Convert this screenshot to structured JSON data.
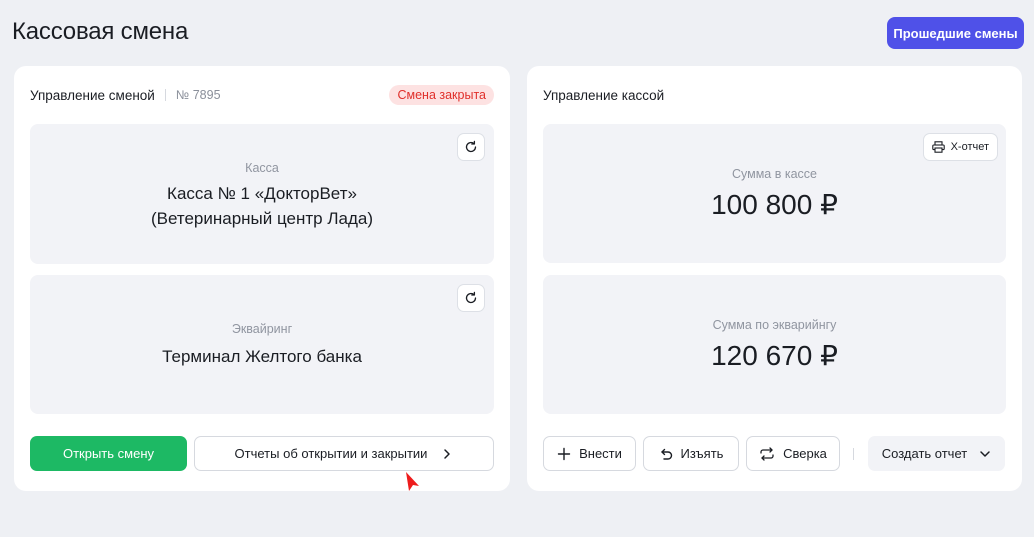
{
  "page": {
    "title": "Кассовая смена"
  },
  "header": {
    "history_button": "Прошедшие смены"
  },
  "shift_card": {
    "title": "Управление сменой",
    "shift_number": "№ 7895",
    "status": "Смена закрыта",
    "register": {
      "caption": "Касса",
      "line1": "Касса № 1 «ДокторВет»",
      "line2": "(Ветеринарный центр Лада)"
    },
    "acquiring": {
      "caption": "Эквайринг",
      "value": "Терминал Желтого банка"
    },
    "open_button": "Открыть смену",
    "reports_button": "Отчеты об открытии и закрытии"
  },
  "cash_card": {
    "title": "Управление кассой",
    "xreport_button": "X-отчет",
    "cash_sum": {
      "caption": "Сумма в кассе",
      "value": "100 800 ₽"
    },
    "acquiring_sum": {
      "caption": "Сумма по экварийнгу",
      "value": "120 670 ₽"
    },
    "deposit_button": "Внести",
    "withdraw_button": "Изъять",
    "reconcile_button": "Сверка",
    "create_report_button": "Создать отчет"
  },
  "colors": {
    "accent": "#4f51e8",
    "success": "#1db964",
    "danger": "#e0302b"
  }
}
